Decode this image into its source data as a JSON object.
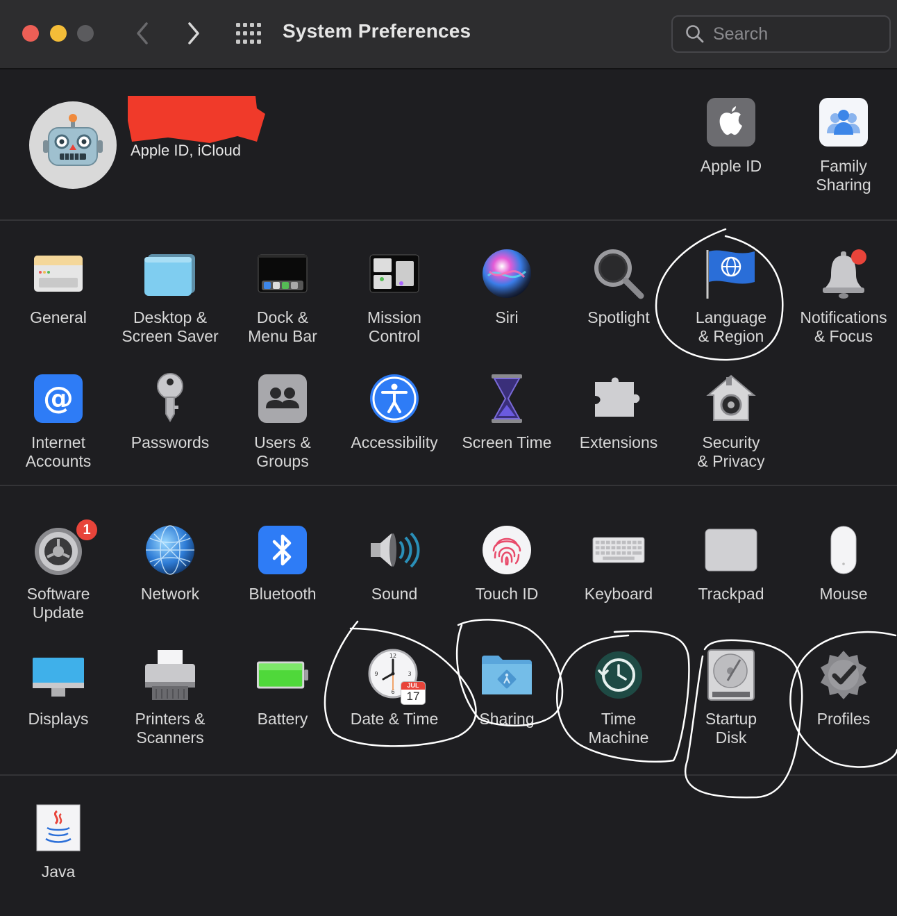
{
  "window": {
    "title": "System Preferences",
    "search_placeholder": "Search"
  },
  "account": {
    "subtitle": "Apple ID, iCloud"
  },
  "colors": {
    "background": "#1e1e21",
    "titlebar": "#2d2d2f",
    "close": "#ed5f56",
    "minimize": "#f4bd38",
    "zoom_disabled": "#5b5b5e",
    "badge": "#e8443a",
    "annotation": "#ffffff"
  },
  "account_items": [
    {
      "label": "Apple ID",
      "icon": "apple-logo-icon"
    },
    {
      "label": "Family\nSharing",
      "icon": "family-sharing-icon"
    }
  ],
  "sections": {
    "personal": [
      {
        "label": "General",
        "icon": "general-window-icon"
      },
      {
        "label": "Desktop &\nScreen Saver",
        "icon": "desktop-screensaver-icon"
      },
      {
        "label": "Dock &\nMenu Bar",
        "icon": "dock-icon"
      },
      {
        "label": "Mission\nControl",
        "icon": "mission-control-icon"
      },
      {
        "label": "Siri",
        "icon": "siri-icon"
      },
      {
        "label": "Spotlight",
        "icon": "magnifier-icon"
      },
      {
        "label": "Language\n& Region",
        "icon": "flag-globe-icon"
      },
      {
        "label": "Notifications\n& Focus",
        "icon": "bell-icon"
      },
      {
        "label": "Internet\nAccounts",
        "icon": "at-sign-icon"
      },
      {
        "label": "Passwords",
        "icon": "key-icon"
      },
      {
        "label": "Users &\nGroups",
        "icon": "users-icon"
      },
      {
        "label": "Accessibility",
        "icon": "accessibility-icon"
      },
      {
        "label": "Screen Time",
        "icon": "hourglass-icon"
      },
      {
        "label": "Extensions",
        "icon": "puzzle-piece-icon"
      },
      {
        "label": "Security\n& Privacy",
        "icon": "house-lock-icon"
      }
    ],
    "hardware": [
      {
        "label": "Software\nUpdate",
        "icon": "gear-update-icon",
        "badge": "1"
      },
      {
        "label": "Network",
        "icon": "network-globe-icon"
      },
      {
        "label": "Bluetooth",
        "icon": "bluetooth-icon"
      },
      {
        "label": "Sound",
        "icon": "speaker-icon"
      },
      {
        "label": "Touch ID",
        "icon": "fingerprint-icon"
      },
      {
        "label": "Keyboard",
        "icon": "keyboard-icon"
      },
      {
        "label": "Trackpad",
        "icon": "trackpad-icon"
      },
      {
        "label": "Mouse",
        "icon": "mouse-icon"
      },
      {
        "label": "Displays",
        "icon": "display-icon"
      },
      {
        "label": "Printers &\nScanners",
        "icon": "printer-icon"
      },
      {
        "label": "Battery",
        "icon": "battery-icon"
      },
      {
        "label": "Date & Time",
        "icon": "clock-calendar-icon",
        "calendar_month": "JUL",
        "calendar_day": "17"
      },
      {
        "label": "Sharing",
        "icon": "shared-folder-icon"
      },
      {
        "label": "Time\nMachine",
        "icon": "time-machine-icon"
      },
      {
        "label": "Startup\nDisk",
        "icon": "hard-disk-icon"
      },
      {
        "label": "Profiles",
        "icon": "badge-check-icon"
      }
    ],
    "other": [
      {
        "label": "Java",
        "icon": "java-cup-icon"
      }
    ]
  }
}
